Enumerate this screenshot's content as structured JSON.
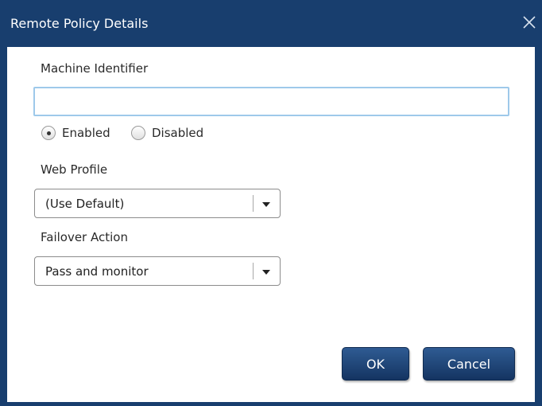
{
  "dialog": {
    "title": "Remote Policy Details",
    "close_icon": "close-icon"
  },
  "machine_identifier": {
    "label": "Machine Identifier",
    "value": "",
    "placeholder": ""
  },
  "status": {
    "options": [
      "Enabled",
      "Disabled"
    ],
    "selected": "Enabled"
  },
  "web_profile": {
    "label": "Web Profile",
    "selected": "(Use Default)",
    "arrow_icon": "caret-down-icon"
  },
  "failover_action": {
    "label": "Failover Action",
    "selected": "Pass and monitor",
    "arrow_icon": "caret-down-icon"
  },
  "buttons": {
    "ok": "OK",
    "cancel": "Cancel"
  },
  "colors": {
    "titlebar": "#183e6e",
    "input_focus_border": "#9ec9ea",
    "button": "#1f4577"
  }
}
